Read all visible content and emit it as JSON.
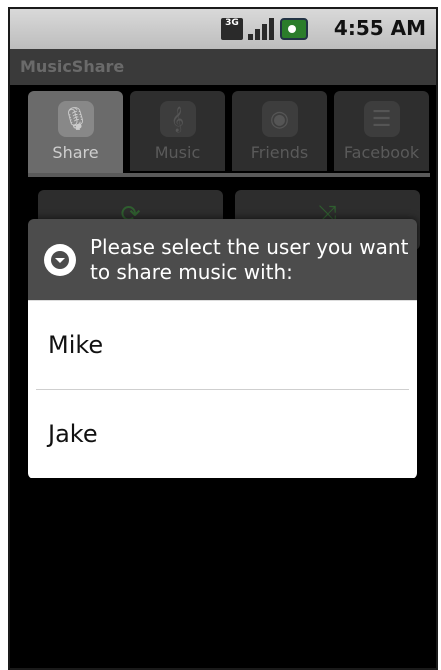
{
  "statusbar": {
    "network_label": "3G",
    "time": "4:55 AM"
  },
  "app": {
    "title": "MusicShare"
  },
  "tabs": [
    {
      "label": "Share",
      "icon": "microphone-icon"
    },
    {
      "label": "Music",
      "icon": "music-note-icon"
    },
    {
      "label": "Friends",
      "icon": "disc-icon"
    },
    {
      "label": "Facebook",
      "icon": "list-icon"
    }
  ],
  "buttons": [
    {
      "icon": "repeat-icon"
    },
    {
      "icon": "shuffle-icon"
    }
  ],
  "dialog": {
    "title": "Please select the user you want to share music with:",
    "items": [
      "Mike",
      "Jake"
    ]
  }
}
